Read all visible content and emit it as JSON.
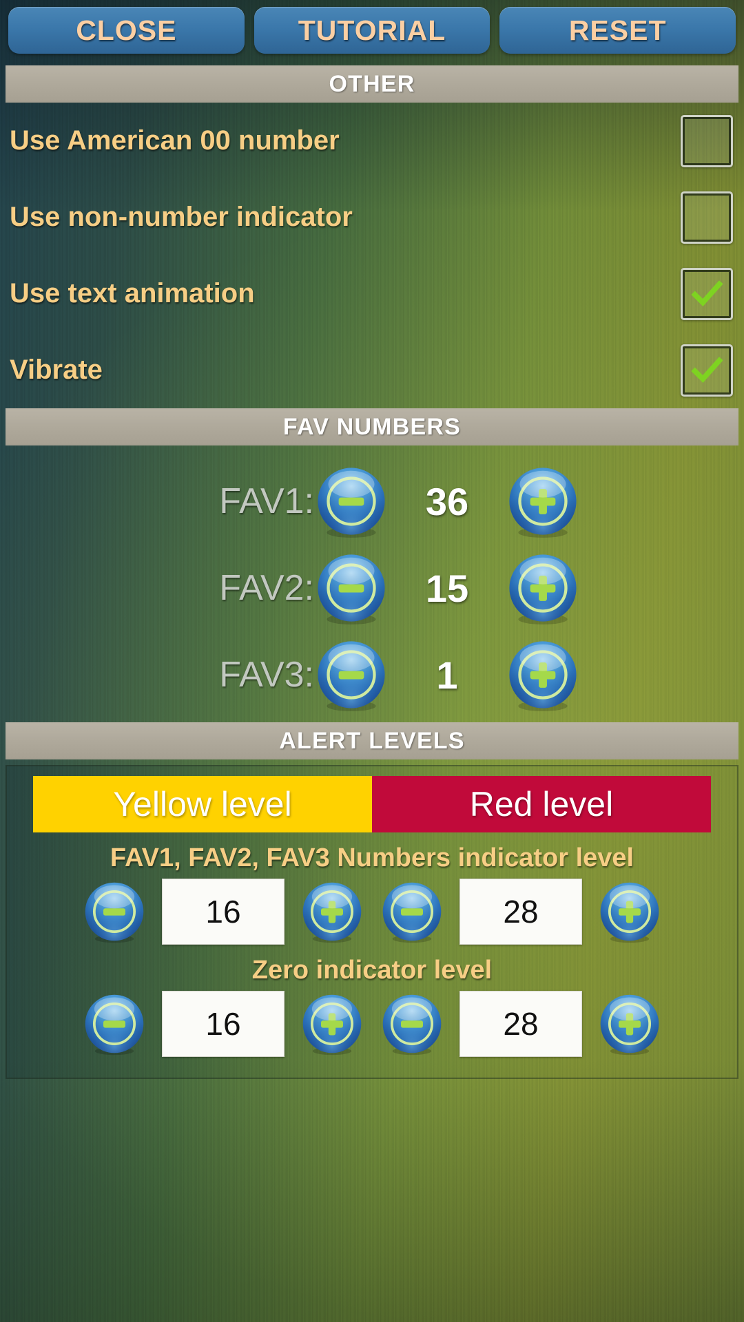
{
  "toolbar": {
    "buttons": [
      {
        "label": "CLOSE",
        "name": "close-button"
      },
      {
        "label": "TUTORIAL",
        "name": "tutorial-button"
      },
      {
        "label": "RESET",
        "name": "reset-button"
      }
    ]
  },
  "sections": {
    "other": "OTHER",
    "fav_numbers": "FAV NUMBERS",
    "alert_levels": "ALERT LEVELS"
  },
  "other_options": [
    {
      "label": "Use American 00 number",
      "checked": false
    },
    {
      "label": "Use non-number indicator",
      "checked": false
    },
    {
      "label": "Use text animation",
      "checked": true
    },
    {
      "label": "Vibrate",
      "checked": true
    }
  ],
  "fav_numbers": [
    {
      "label": "FAV1:",
      "value": "36"
    },
    {
      "label": "FAV2:",
      "value": "15"
    },
    {
      "label": "FAV3:",
      "value": "1"
    }
  ],
  "alert_levels": {
    "tabs": [
      {
        "label": "Yellow level",
        "color": "#ffd200"
      },
      {
        "label": "Red level",
        "color": "#c10a3a"
      }
    ],
    "groups": [
      {
        "label": "FAV1, FAV2, FAV3 Numbers indicator level",
        "yellow_value": "16",
        "red_value": "28"
      },
      {
        "label": "Zero indicator level",
        "yellow_value": "16",
        "red_value": "28"
      }
    ]
  },
  "icons": {
    "minus": "minus-orb-icon",
    "plus": "plus-orb-icon",
    "check": "checkmark-icon"
  },
  "colors": {
    "label_gold": "#f7ce85",
    "button_blue": "#3b78ab",
    "button_text": "#fbcfa3",
    "header_bar": "#aea89a",
    "orb_blue": "#2f6fb5",
    "orb_green": "#a5d94a",
    "check_green": "#7ed321",
    "yellow": "#ffd200",
    "red": "#c10a3a"
  }
}
